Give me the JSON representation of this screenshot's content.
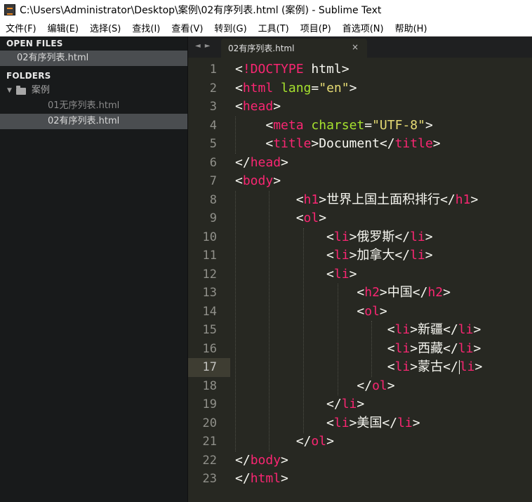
{
  "window": {
    "title": "C:\\Users\\Administrator\\Desktop\\案例\\02有序列表.html (案例) - Sublime Text"
  },
  "menu": [
    "文件(F)",
    "编辑(E)",
    "选择(S)",
    "查找(I)",
    "查看(V)",
    "转到(G)",
    "工具(T)",
    "项目(P)",
    "首选项(N)",
    "帮助(H)"
  ],
  "sidebar": {
    "open_files_heading": "OPEN FILES",
    "open_files": [
      "02有序列表.html"
    ],
    "folders_heading": "FOLDERS",
    "folder_name": "案例",
    "files": [
      "01无序列表.html",
      "02有序列表.html"
    ]
  },
  "tabbar": {
    "nav": "◄►",
    "tab_label": "02有序列表.html",
    "close_glyph": "×"
  },
  "editor": {
    "current_line": 17,
    "lines": [
      {
        "n": "1",
        "tokens": [
          [
            "p",
            "<"
          ],
          [
            "d",
            "!DOCTYPE"
          ],
          [
            "p",
            " html>"
          ]
        ]
      },
      {
        "n": "2",
        "tokens": [
          [
            "p",
            "<"
          ],
          [
            "t",
            "html"
          ],
          [
            "p",
            " "
          ],
          [
            "a",
            "lang"
          ],
          [
            "p",
            "="
          ],
          [
            "s",
            "\"en\""
          ],
          [
            "p",
            ">"
          ]
        ]
      },
      {
        "n": "3",
        "tokens": [
          [
            "p",
            "<"
          ],
          [
            "t",
            "head"
          ],
          [
            "p",
            ">"
          ]
        ]
      },
      {
        "n": "4",
        "tokens": [
          [
            "p",
            "    <"
          ],
          [
            "t",
            "meta"
          ],
          [
            "p",
            " "
          ],
          [
            "a",
            "charset"
          ],
          [
            "p",
            "="
          ],
          [
            "s",
            "\"UTF-8\""
          ],
          [
            "p",
            ">"
          ]
        ]
      },
      {
        "n": "5",
        "tokens": [
          [
            "p",
            "    <"
          ],
          [
            "t",
            "title"
          ],
          [
            "p",
            ">Document</"
          ],
          [
            "t",
            "title"
          ],
          [
            "p",
            ">"
          ]
        ]
      },
      {
        "n": "6",
        "tokens": [
          [
            "p",
            "</"
          ],
          [
            "t",
            "head"
          ],
          [
            "p",
            ">"
          ]
        ]
      },
      {
        "n": "7",
        "tokens": [
          [
            "p",
            "<"
          ],
          [
            "t",
            "body"
          ],
          [
            "p",
            ">"
          ]
        ]
      },
      {
        "n": "8",
        "tokens": [
          [
            "p",
            "        <"
          ],
          [
            "t",
            "h1"
          ],
          [
            "p",
            ">世界上国土面积排行</"
          ],
          [
            "t",
            "h1"
          ],
          [
            "p",
            ">"
          ]
        ]
      },
      {
        "n": "9",
        "tokens": [
          [
            "p",
            "        <"
          ],
          [
            "t",
            "ol"
          ],
          [
            "p",
            ">"
          ]
        ]
      },
      {
        "n": "10",
        "tokens": [
          [
            "p",
            "            <"
          ],
          [
            "t",
            "li"
          ],
          [
            "p",
            ">俄罗斯</"
          ],
          [
            "t",
            "li"
          ],
          [
            "p",
            ">"
          ]
        ]
      },
      {
        "n": "11",
        "tokens": [
          [
            "p",
            "            <"
          ],
          [
            "t",
            "li"
          ],
          [
            "p",
            ">加拿大</"
          ],
          [
            "t",
            "li"
          ],
          [
            "p",
            ">"
          ]
        ]
      },
      {
        "n": "12",
        "tokens": [
          [
            "p",
            "            <"
          ],
          [
            "t",
            "li"
          ],
          [
            "p",
            ">"
          ]
        ]
      },
      {
        "n": "13",
        "tokens": [
          [
            "p",
            "                <"
          ],
          [
            "t",
            "h2"
          ],
          [
            "p",
            ">中国</"
          ],
          [
            "t",
            "h2"
          ],
          [
            "p",
            ">"
          ]
        ]
      },
      {
        "n": "14",
        "tokens": [
          [
            "p",
            "                <"
          ],
          [
            "t",
            "ol"
          ],
          [
            "p",
            ">"
          ]
        ]
      },
      {
        "n": "15",
        "tokens": [
          [
            "p",
            "                    <"
          ],
          [
            "t",
            "li"
          ],
          [
            "p",
            ">新疆</"
          ],
          [
            "t",
            "li"
          ],
          [
            "p",
            ">"
          ]
        ]
      },
      {
        "n": "16",
        "tokens": [
          [
            "p",
            "                    <"
          ],
          [
            "t",
            "li"
          ],
          [
            "p",
            ">西藏</"
          ],
          [
            "t",
            "li"
          ],
          [
            "p",
            ">"
          ]
        ]
      },
      {
        "n": "17",
        "tokens": [
          [
            "p",
            "                    <"
          ],
          [
            "t",
            "li"
          ],
          [
            "p",
            ">蒙古</"
          ],
          [
            "t",
            "li"
          ],
          [
            "p",
            ">"
          ]
        ]
      },
      {
        "n": "18",
        "tokens": [
          [
            "p",
            "                </"
          ],
          [
            "t",
            "ol"
          ],
          [
            "p",
            ">"
          ]
        ]
      },
      {
        "n": "19",
        "tokens": [
          [
            "p",
            "            </"
          ],
          [
            "t",
            "li"
          ],
          [
            "p",
            ">"
          ]
        ]
      },
      {
        "n": "20",
        "tokens": [
          [
            "p",
            "            <"
          ],
          [
            "t",
            "li"
          ],
          [
            "p",
            ">美国</"
          ],
          [
            "t",
            "li"
          ],
          [
            "p",
            ">"
          ]
        ]
      },
      {
        "n": "21",
        "tokens": [
          [
            "p",
            "        </"
          ],
          [
            "t",
            "ol"
          ],
          [
            "p",
            ">"
          ]
        ]
      },
      {
        "n": "22",
        "tokens": [
          [
            "p",
            "</"
          ],
          [
            "t",
            "body"
          ],
          [
            "p",
            ">"
          ]
        ]
      },
      {
        "n": "23",
        "tokens": [
          [
            "p",
            "</"
          ],
          [
            "t",
            "html"
          ],
          [
            "p",
            ">"
          ]
        ]
      }
    ]
  },
  "colors": {
    "editor_bg": "#272822",
    "sidebar_bg": "#181a1b",
    "tag": "#f92672",
    "attribute": "#a6e22e",
    "string": "#e6db74",
    "text": "#f8f8f2",
    "line_number": "#90908a"
  }
}
